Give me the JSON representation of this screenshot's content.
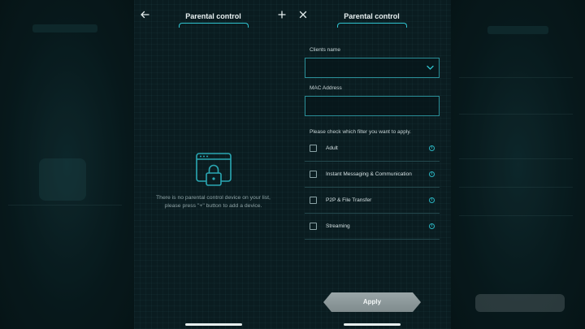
{
  "left_panel": {
    "title": "Parental control",
    "empty_message_line1": "There is no parental control device on your list,",
    "empty_message_line2": "please press \"+\" button to add a device.",
    "back_icon": "arrow-left-icon",
    "add_icon": "plus-icon"
  },
  "right_panel": {
    "title": "Parental control",
    "close_icon": "close-icon",
    "clients_name_label": "Clients name",
    "clients_name_value": "",
    "mac_address_label": "MAC Address",
    "mac_address_value": "",
    "filter_prompt": "Please check which filter you want to apply.",
    "filters": [
      {
        "label": "Adult",
        "checked": false
      },
      {
        "label": "Instant Messaging & Communication",
        "checked": false
      },
      {
        "label": "P2P & File Transfer",
        "checked": false
      },
      {
        "label": "Streaming",
        "checked": false
      }
    ],
    "apply_label": "Apply"
  },
  "colors": {
    "accent": "#2fc4d0",
    "background": "#0a1c20",
    "button": "#8f9b9d"
  }
}
